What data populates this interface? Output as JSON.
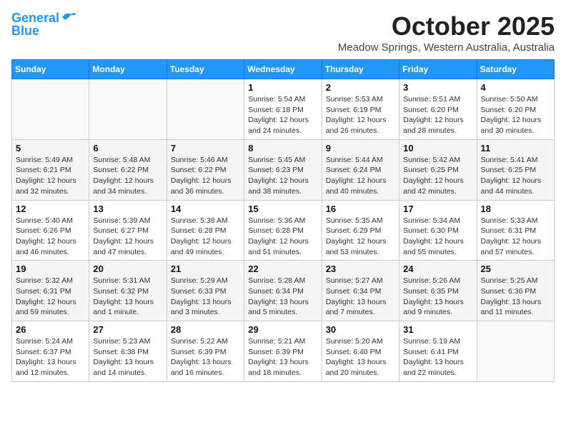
{
  "logo": {
    "line1": "General",
    "line2": "Blue"
  },
  "title": "October 2025",
  "location": "Meadow Springs, Western Australia, Australia",
  "days_of_week": [
    "Sunday",
    "Monday",
    "Tuesday",
    "Wednesday",
    "Thursday",
    "Friday",
    "Saturday"
  ],
  "weeks": [
    [
      {
        "day": "",
        "info": ""
      },
      {
        "day": "",
        "info": ""
      },
      {
        "day": "",
        "info": ""
      },
      {
        "day": "1",
        "info": "Sunrise: 5:54 AM\nSunset: 6:18 PM\nDaylight: 12 hours\nand 24 minutes."
      },
      {
        "day": "2",
        "info": "Sunrise: 5:53 AM\nSunset: 6:19 PM\nDaylight: 12 hours\nand 26 minutes."
      },
      {
        "day": "3",
        "info": "Sunrise: 5:51 AM\nSunset: 6:20 PM\nDaylight: 12 hours\nand 28 minutes."
      },
      {
        "day": "4",
        "info": "Sunrise: 5:50 AM\nSunset: 6:20 PM\nDaylight: 12 hours\nand 30 minutes."
      }
    ],
    [
      {
        "day": "5",
        "info": "Sunrise: 5:49 AM\nSunset: 6:21 PM\nDaylight: 12 hours\nand 32 minutes."
      },
      {
        "day": "6",
        "info": "Sunrise: 5:48 AM\nSunset: 6:22 PM\nDaylight: 12 hours\nand 34 minutes."
      },
      {
        "day": "7",
        "info": "Sunrise: 5:46 AM\nSunset: 6:22 PM\nDaylight: 12 hours\nand 36 minutes."
      },
      {
        "day": "8",
        "info": "Sunrise: 5:45 AM\nSunset: 6:23 PM\nDaylight: 12 hours\nand 38 minutes."
      },
      {
        "day": "9",
        "info": "Sunrise: 5:44 AM\nSunset: 6:24 PM\nDaylight: 12 hours\nand 40 minutes."
      },
      {
        "day": "10",
        "info": "Sunrise: 5:42 AM\nSunset: 6:25 PM\nDaylight: 12 hours\nand 42 minutes."
      },
      {
        "day": "11",
        "info": "Sunrise: 5:41 AM\nSunset: 6:25 PM\nDaylight: 12 hours\nand 44 minutes."
      }
    ],
    [
      {
        "day": "12",
        "info": "Sunrise: 5:40 AM\nSunset: 6:26 PM\nDaylight: 12 hours\nand 46 minutes."
      },
      {
        "day": "13",
        "info": "Sunrise: 5:39 AM\nSunset: 6:27 PM\nDaylight: 12 hours\nand 47 minutes."
      },
      {
        "day": "14",
        "info": "Sunrise: 5:38 AM\nSunset: 6:28 PM\nDaylight: 12 hours\nand 49 minutes."
      },
      {
        "day": "15",
        "info": "Sunrise: 5:36 AM\nSunset: 6:28 PM\nDaylight: 12 hours\nand 51 minutes."
      },
      {
        "day": "16",
        "info": "Sunrise: 5:35 AM\nSunset: 6:29 PM\nDaylight: 12 hours\nand 53 minutes."
      },
      {
        "day": "17",
        "info": "Sunrise: 5:34 AM\nSunset: 6:30 PM\nDaylight: 12 hours\nand 55 minutes."
      },
      {
        "day": "18",
        "info": "Sunrise: 5:33 AM\nSunset: 6:31 PM\nDaylight: 12 hours\nand 57 minutes."
      }
    ],
    [
      {
        "day": "19",
        "info": "Sunrise: 5:32 AM\nSunset: 6:31 PM\nDaylight: 12 hours\nand 59 minutes."
      },
      {
        "day": "20",
        "info": "Sunrise: 5:31 AM\nSunset: 6:32 PM\nDaylight: 13 hours\nand 1 minute."
      },
      {
        "day": "21",
        "info": "Sunrise: 5:29 AM\nSunset: 6:33 PM\nDaylight: 13 hours\nand 3 minutes."
      },
      {
        "day": "22",
        "info": "Sunrise: 5:28 AM\nSunset: 6:34 PM\nDaylight: 13 hours\nand 5 minutes."
      },
      {
        "day": "23",
        "info": "Sunrise: 5:27 AM\nSunset: 6:34 PM\nDaylight: 13 hours\nand 7 minutes."
      },
      {
        "day": "24",
        "info": "Sunrise: 5:26 AM\nSunset: 6:35 PM\nDaylight: 13 hours\nand 9 minutes."
      },
      {
        "day": "25",
        "info": "Sunrise: 5:25 AM\nSunset: 6:36 PM\nDaylight: 13 hours\nand 11 minutes."
      }
    ],
    [
      {
        "day": "26",
        "info": "Sunrise: 5:24 AM\nSunset: 6:37 PM\nDaylight: 13 hours\nand 12 minutes."
      },
      {
        "day": "27",
        "info": "Sunrise: 5:23 AM\nSunset: 6:38 PM\nDaylight: 13 hours\nand 14 minutes."
      },
      {
        "day": "28",
        "info": "Sunrise: 5:22 AM\nSunset: 6:39 PM\nDaylight: 13 hours\nand 16 minutes."
      },
      {
        "day": "29",
        "info": "Sunrise: 5:21 AM\nSunset: 6:39 PM\nDaylight: 13 hours\nand 18 minutes."
      },
      {
        "day": "30",
        "info": "Sunrise: 5:20 AM\nSunset: 6:40 PM\nDaylight: 13 hours\nand 20 minutes."
      },
      {
        "day": "31",
        "info": "Sunrise: 5:19 AM\nSunset: 6:41 PM\nDaylight: 13 hours\nand 22 minutes."
      },
      {
        "day": "",
        "info": ""
      }
    ]
  ]
}
